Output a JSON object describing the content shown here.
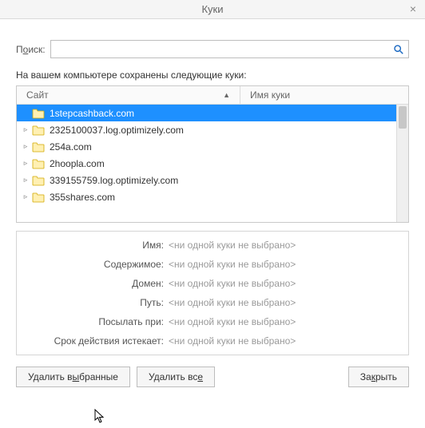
{
  "title": "Куки",
  "search": {
    "label_pre": "П",
    "label_u": "о",
    "label_post": "иск:",
    "placeholder": "",
    "value": ""
  },
  "intro": "На вашем компьютере сохранены следующие куки:",
  "columns": {
    "site": "Сайт",
    "name": "Имя куки",
    "sort_indicator": "▲"
  },
  "rows": [
    {
      "site": "1stepcashback.com",
      "selected": true,
      "expandable": false
    },
    {
      "site": "2325100037.log.optimizely.com",
      "selected": false,
      "expandable": true
    },
    {
      "site": "254a.com",
      "selected": false,
      "expandable": true
    },
    {
      "site": "2hoopla.com",
      "selected": false,
      "expandable": true
    },
    {
      "site": "339155759.log.optimizely.com",
      "selected": false,
      "expandable": true
    },
    {
      "site": "355shares.com",
      "selected": false,
      "expandable": true
    }
  ],
  "details": {
    "placeholder": "<ни одной куки не выбрано>",
    "labels": {
      "name": "Имя:",
      "content": "Содержимое:",
      "domain": "Домен:",
      "path": "Путь:",
      "send": "Посылать при:",
      "expires": "Срок действия истекает:"
    }
  },
  "buttons": {
    "remove_selected_pre": "Удалить в",
    "remove_selected_u": "ы",
    "remove_selected_post": "бранные",
    "remove_all_pre": "Удалить вс",
    "remove_all_u": "е",
    "remove_all_post": "",
    "close_pre": "За",
    "close_u": "к",
    "close_post": "рыть"
  },
  "colors": {
    "selection": "#1e90ff",
    "folder_fill": "#fff0b3",
    "folder_stroke": "#d1a800",
    "accent_icon": "#1565c0"
  }
}
